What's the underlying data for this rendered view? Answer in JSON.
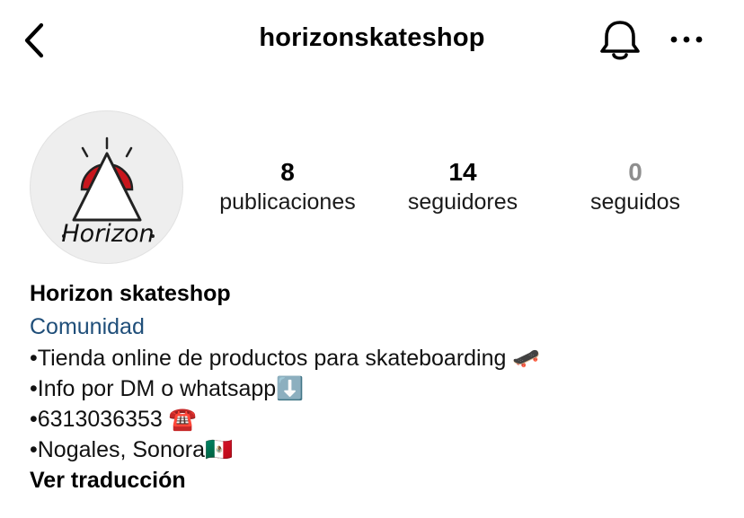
{
  "header": {
    "username": "horizonskateshop",
    "back_icon": "chevron-left-icon",
    "notification_icon": "bell-icon",
    "more_icon": "more-horizontal-icon"
  },
  "profile": {
    "avatar_logo_text": "Horizon",
    "stats": [
      {
        "value": "8",
        "label": "publicaciones"
      },
      {
        "value": "14",
        "label": "seguidores"
      },
      {
        "value": "0",
        "label": "seguidos"
      }
    ]
  },
  "bio": {
    "name": "Horizon skateshop",
    "category": "Comunidad",
    "lines": [
      "•Tienda online de productos para skateboarding 🛹",
      "•Info por DM o whatsapp⬇️",
      "•6313036353 ☎️",
      "•Nogales, Sonora🇲🇽"
    ],
    "translate_label": "Ver traducción"
  },
  "colors": {
    "category_link": "#1f4e79",
    "following_count": "#8e8e8e",
    "logo_red": "#c8161d"
  }
}
